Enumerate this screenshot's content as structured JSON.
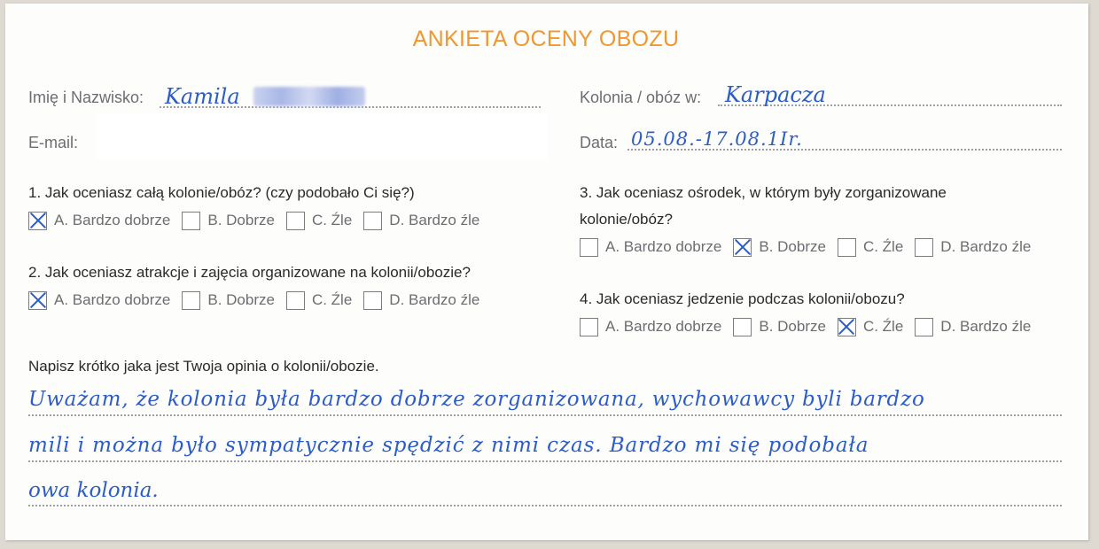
{
  "form": {
    "title": "ANKIETA OCENY OBOZU",
    "name_label": "Imię i Nazwisko:",
    "name_value": "Kamila",
    "email_label": "E-mail:",
    "camp_label": "Kolonia / obóz w:",
    "camp_value": "Karpacza",
    "date_label": "Data:",
    "date_value": "05.08.-17.08.1Ir."
  },
  "questions": [
    {
      "text": "1. Jak oceniasz całą kolonie/obóz? (czy podobało Ci się?)",
      "options": [
        "A. Bardzo dobrze",
        "B. Dobrze",
        "C. Źle",
        "D. Bardzo źle"
      ],
      "selected": 0
    },
    {
      "text": "2.  Jak oceniasz atrakcje i zajęcia organizowane na kolonii/obozie?",
      "options": [
        "A. Bardzo dobrze",
        "B. Dobrze",
        "C. Źle",
        "D. Bardzo źle"
      ],
      "selected": 0
    },
    {
      "text_line1": "3. Jak oceniasz ośrodek, w którym były zorganizowane",
      "text_line2": "kolonie/obóz?",
      "options": [
        "A. Bardzo dobrze",
        "B. Dobrze",
        "C. Źle",
        "D. Bardzo źle"
      ],
      "selected": 1
    },
    {
      "text": "4.  Jak oceniasz jedzenie podczas kolonii/obozu?",
      "options": [
        "A. Bardzo dobrze",
        "B. Dobrze",
        "C. Źle",
        "D. Bardzo źle"
      ],
      "selected": 2
    }
  ],
  "opinion": {
    "prompt": "Napisz krótko jaka jest Twoja opinia o kolonii/obozie.",
    "lines": [
      "Uważam, że kolonia była bardzo dobrze zorganizowana, wychowawcy byli bardzo",
      "mili i można było sympatycznie spędzić z nimi czas. Bardzo mi się podobała",
      "owa kolonia."
    ]
  },
  "colors": {
    "title": "#f0972f",
    "handwriting": "#2b5cc8",
    "card": "#fdfdfb"
  }
}
